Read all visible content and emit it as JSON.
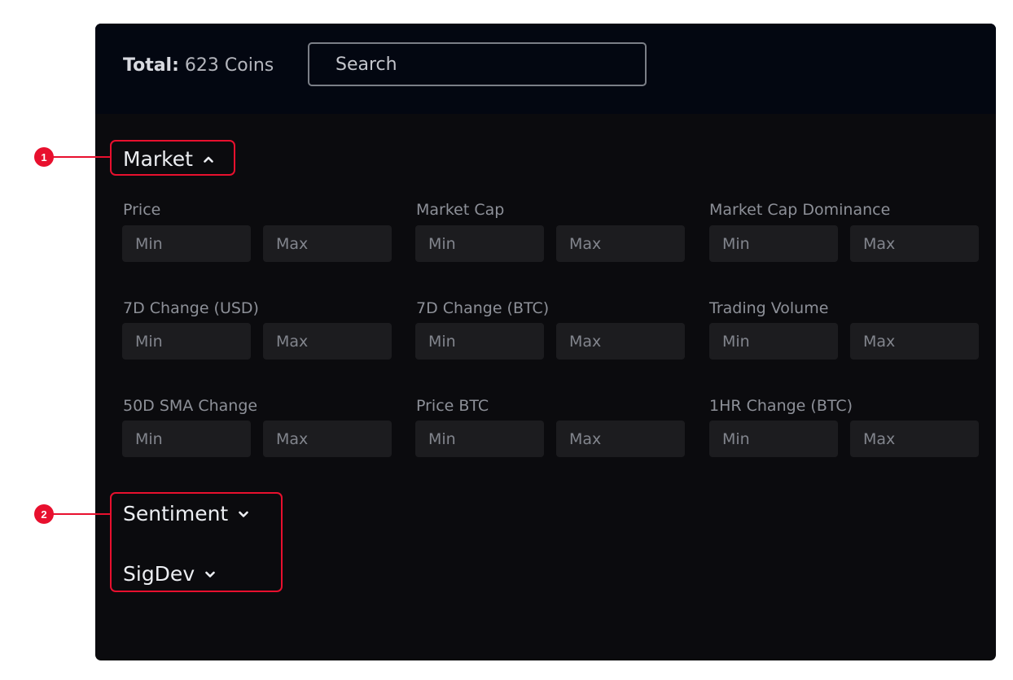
{
  "topbar": {
    "total_label": "Total:",
    "total_value": "623 Coins",
    "search_placeholder": "Search"
  },
  "sections": {
    "market": {
      "label": "Market",
      "icon": "chevron-up-icon",
      "expanded": true
    },
    "sentiment": {
      "label": "Sentiment",
      "icon": "chevron-down-icon",
      "expanded": false
    },
    "sigdev": {
      "label": "SigDev",
      "icon": "chevron-down-icon",
      "expanded": false
    }
  },
  "filters": [
    {
      "label": "Price",
      "min_placeholder": "Min",
      "max_placeholder": "Max"
    },
    {
      "label": "Market Cap",
      "min_placeholder": "Min",
      "max_placeholder": "Max"
    },
    {
      "label": "Market Cap Dominance",
      "min_placeholder": "Min",
      "max_placeholder": "Max"
    },
    {
      "label": "7D Change (USD)",
      "min_placeholder": "Min",
      "max_placeholder": "Max"
    },
    {
      "label": "7D Change (BTC)",
      "min_placeholder": "Min",
      "max_placeholder": "Max"
    },
    {
      "label": "Trading Volume",
      "min_placeholder": "Min",
      "max_placeholder": "Max"
    },
    {
      "label": "50D SMA Change",
      "min_placeholder": "Min",
      "max_placeholder": "Max"
    },
    {
      "label": "Price BTC",
      "min_placeholder": "Min",
      "max_placeholder": "Max"
    },
    {
      "label": "1HR Change (BTC)",
      "min_placeholder": "Min",
      "max_placeholder": "Max"
    }
  ],
  "callouts": [
    {
      "number": "1"
    },
    {
      "number": "2"
    }
  ],
  "colors": {
    "panel_bg": "#0b0b0e",
    "topbar_bg": "#030711",
    "input_bg": "#1c1c1f",
    "callout_red": "#e8102e"
  }
}
